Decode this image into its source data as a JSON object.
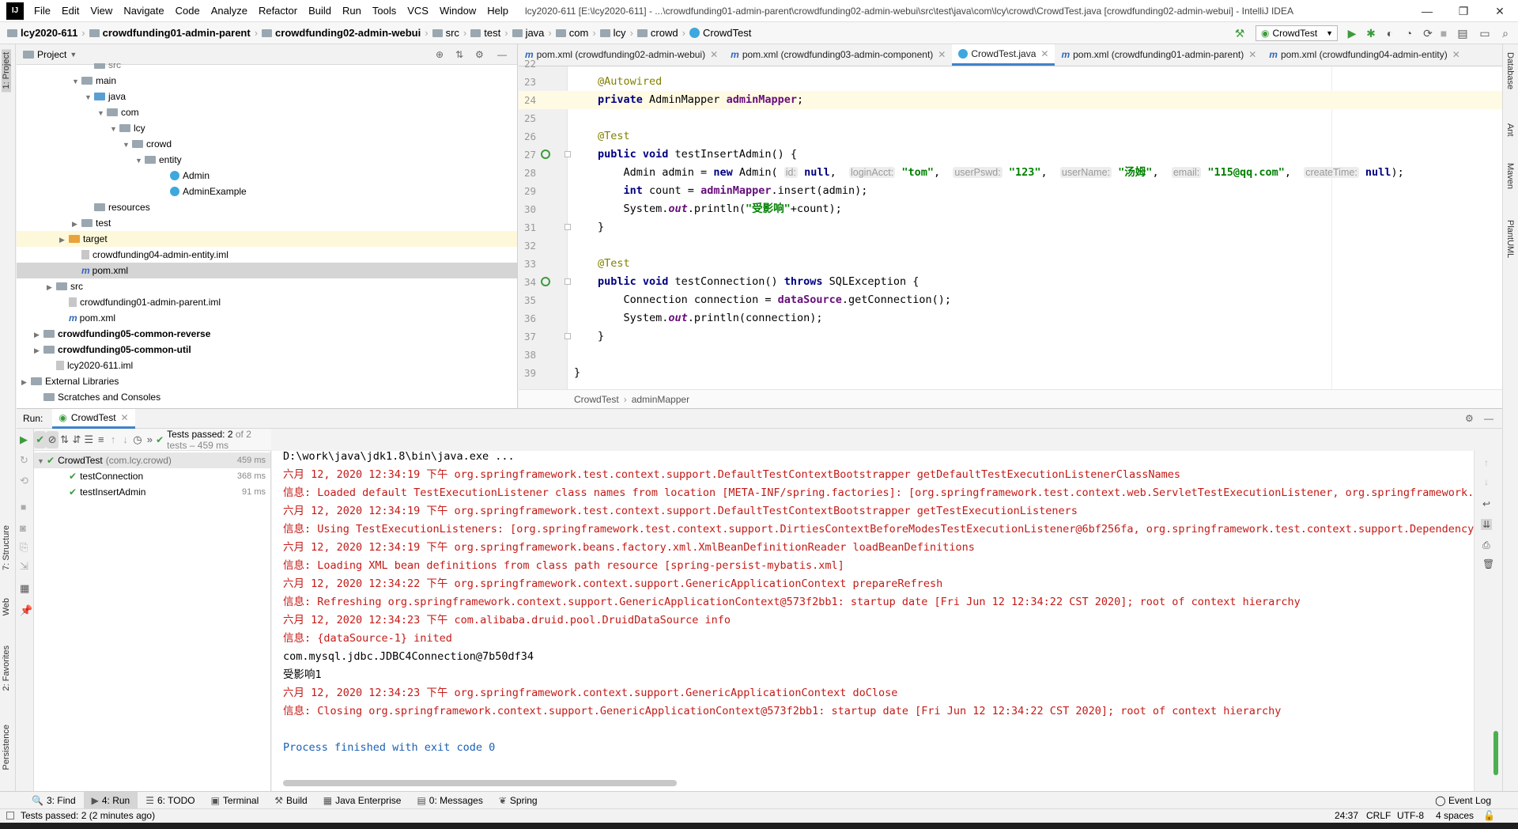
{
  "titlebar": {
    "logo": "IJ",
    "menu": [
      "File",
      "Edit",
      "View",
      "Navigate",
      "Code",
      "Analyze",
      "Refactor",
      "Build",
      "Run",
      "Tools",
      "VCS",
      "Window",
      "Help"
    ],
    "title": "lcy2020-611 [E:\\lcy2020-611] - ...\\crowdfunding01-admin-parent\\crowdfunding02-admin-webui\\src\\test\\java\\com\\lcy\\crowd\\CrowdTest.java [crowdfunding02-admin-webui] - IntelliJ IDEA",
    "minimize": "—",
    "maximize": "❐",
    "close": "✕"
  },
  "navbar": {
    "crumbs": [
      "lcy2020-611",
      "crowdfunding01-admin-parent",
      "crowdfunding02-admin-webui",
      "src",
      "test",
      "java",
      "com",
      "lcy",
      "crowd",
      "CrowdTest"
    ],
    "run_config": "CrowdTest"
  },
  "left_strip": {
    "project_tab": "1: Project",
    "structure_tab": "7: Structure",
    "web_tab": "Web",
    "favorites_tab": "2: Favorites",
    "persistence_tab": "Persistence"
  },
  "right_strip": {
    "database": "Database",
    "ant": "Ant",
    "maven": "Maven",
    "plantuml": "PlantUML"
  },
  "project": {
    "header": "Project",
    "tree": [
      {
        "label": "src",
        "indent": 5,
        "icon": "folder",
        "arrow": "",
        "cls": "grey"
      },
      {
        "label": "main",
        "indent": 4,
        "icon": "folder",
        "arrow": "▼",
        "cls": ""
      },
      {
        "label": "java",
        "indent": 5,
        "icon": "folder-blue",
        "arrow": "▼",
        "cls": ""
      },
      {
        "label": "com",
        "indent": 6,
        "icon": "folder",
        "arrow": "▼",
        "cls": ""
      },
      {
        "label": "lcy",
        "indent": 7,
        "icon": "folder",
        "arrow": "▼",
        "cls": ""
      },
      {
        "label": "crowd",
        "indent": 8,
        "icon": "folder",
        "arrow": "▼",
        "cls": ""
      },
      {
        "label": "entity",
        "indent": 9,
        "icon": "folder",
        "arrow": "▼",
        "cls": ""
      },
      {
        "label": "Admin",
        "indent": 11,
        "icon": "class",
        "arrow": "",
        "cls": ""
      },
      {
        "label": "AdminExample",
        "indent": 11,
        "icon": "class",
        "arrow": "",
        "cls": ""
      },
      {
        "label": "resources",
        "indent": 5,
        "icon": "folder",
        "arrow": "",
        "cls": ""
      },
      {
        "label": "test",
        "indent": 4,
        "icon": "folder",
        "arrow": "▶",
        "cls": ""
      },
      {
        "label": "target",
        "indent": 3,
        "icon": "folder-orange",
        "arrow": "▶",
        "cls": "hl"
      },
      {
        "label": "crowdfunding04-admin-entity.iml",
        "indent": 4,
        "icon": "file",
        "arrow": "",
        "cls": ""
      },
      {
        "label": "pom.xml",
        "indent": 4,
        "icon": "m",
        "arrow": "",
        "cls": "sel"
      },
      {
        "label": "src",
        "indent": 2,
        "icon": "folder",
        "arrow": "▶",
        "cls": ""
      },
      {
        "label": "crowdfunding01-admin-parent.iml",
        "indent": 3,
        "icon": "file",
        "arrow": "",
        "cls": ""
      },
      {
        "label": "pom.xml",
        "indent": 3,
        "icon": "m",
        "arrow": "",
        "cls": ""
      },
      {
        "label": "crowdfunding05-common-reverse",
        "indent": 1,
        "icon": "folder",
        "arrow": "▶",
        "cls": "bold"
      },
      {
        "label": "crowdfunding05-common-util",
        "indent": 1,
        "icon": "folder",
        "arrow": "▶",
        "cls": "bold"
      },
      {
        "label": "lcy2020-611.iml",
        "indent": 2,
        "icon": "file",
        "arrow": "",
        "cls": ""
      },
      {
        "label": "External Libraries",
        "indent": 0,
        "icon": "folder",
        "arrow": "▶",
        "cls": ""
      },
      {
        "label": "Scratches and Consoles",
        "indent": 1,
        "icon": "folder",
        "arrow": "",
        "cls": ""
      }
    ]
  },
  "editor": {
    "tabs": [
      {
        "label": "pom.xml (crowdfunding02-admin-webui)",
        "icon": "m",
        "active": false
      },
      {
        "label": "pom.xml (crowdfunding03-admin-component)",
        "icon": "m",
        "active": false
      },
      {
        "label": "CrowdTest.java",
        "icon": "c",
        "active": true
      },
      {
        "label": "pom.xml (crowdfunding01-admin-parent)",
        "icon": "m",
        "active": false
      },
      {
        "label": "pom.xml (crowdfunding04-admin-entity)",
        "icon": "m",
        "active": false
      }
    ],
    "line_numbers": [
      "22",
      "23",
      "24",
      "25",
      "26",
      "27",
      "28",
      "29",
      "30",
      "31",
      "32",
      "33",
      "34",
      "35",
      "36",
      "37",
      "38",
      "39"
    ],
    "breadcrumb": [
      "CrowdTest",
      "adminMapper"
    ]
  },
  "run": {
    "label": "Run:",
    "tab": "CrowdTest",
    "status": "Tests passed:",
    "status_count": "2",
    "status_detail": "of 2 tests – 459 ms",
    "tests": [
      {
        "name": "CrowdTest",
        "pkg": "(com.lcy.crowd)",
        "duration": "459 ms"
      },
      {
        "name": "testConnection",
        "pkg": "",
        "duration": "368 ms"
      },
      {
        "name": "testInsertAdmin",
        "pkg": "",
        "duration": "91 ms"
      }
    ],
    "console": [
      {
        "text": "D:\\work\\java\\jdk1.8\\bin\\java.exe ...",
        "cls": "cblack"
      },
      {
        "text": "六月 12, 2020 12:34:19 下午 org.springframework.test.context.support.DefaultTestContextBootstrapper getDefaultTestExecutionListenerClassNames",
        "cls": "cred"
      },
      {
        "text": "信息: Loaded default TestExecutionListener class names from location [META-INF/spring.factories]: [org.springframework.test.context.web.ServletTestExecutionListener, org.springframework.test",
        "cls": "cred"
      },
      {
        "text": "六月 12, 2020 12:34:19 下午 org.springframework.test.context.support.DefaultTestContextBootstrapper getTestExecutionListeners",
        "cls": "cred"
      },
      {
        "text": "信息: Using TestExecutionListeners: [org.springframework.test.context.support.DirtiesContextBeforeModesTestExecutionListener@6bf256fa, org.springframework.test.context.support.DependencyInje",
        "cls": "cred"
      },
      {
        "text": "六月 12, 2020 12:34:19 下午 org.springframework.beans.factory.xml.XmlBeanDefinitionReader loadBeanDefinitions",
        "cls": "cred"
      },
      {
        "text": "信息: Loading XML bean definitions from class path resource [spring-persist-mybatis.xml]",
        "cls": "cred"
      },
      {
        "text": "六月 12, 2020 12:34:22 下午 org.springframework.context.support.GenericApplicationContext prepareRefresh",
        "cls": "cred"
      },
      {
        "text": "信息: Refreshing org.springframework.context.support.GenericApplicationContext@573f2bb1: startup date [Fri Jun 12 12:34:22 CST 2020]; root of context hierarchy",
        "cls": "cred"
      },
      {
        "text": "六月 12, 2020 12:34:23 下午 com.alibaba.druid.pool.DruidDataSource info",
        "cls": "cred"
      },
      {
        "text": "信息: {dataSource-1} inited",
        "cls": "cred"
      },
      {
        "text": "com.mysql.jdbc.JDBC4Connection@7b50df34",
        "cls": "cblack"
      },
      {
        "text": "受影响1",
        "cls": "cblack"
      },
      {
        "text": "六月 12, 2020 12:34:23 下午 org.springframework.context.support.GenericApplicationContext doClose",
        "cls": "cred"
      },
      {
        "text": "信息: Closing org.springframework.context.support.GenericApplicationContext@573f2bb1: startup date [Fri Jun 12 12:34:22 CST 2020]; root of context hierarchy",
        "cls": "cred"
      },
      {
        "text": "",
        "cls": "cblack"
      },
      {
        "text": "Process finished with exit code 0",
        "cls": "cblue"
      }
    ]
  },
  "bottom_tools": [
    {
      "label": "3: Find",
      "icon": "🔍",
      "active": false
    },
    {
      "label": "4: Run",
      "icon": "▶",
      "active": true
    },
    {
      "label": "6: TODO",
      "icon": "☰",
      "active": false
    },
    {
      "label": "Terminal",
      "icon": "▣",
      "active": false
    },
    {
      "label": "Build",
      "icon": "⚒",
      "active": false
    },
    {
      "label": "Java Enterprise",
      "icon": "▦",
      "active": false
    },
    {
      "label": "0: Messages",
      "icon": "▤",
      "active": false
    },
    {
      "label": "Spring",
      "icon": "❦",
      "active": false
    }
  ],
  "event_log": "Event Log",
  "status": {
    "message": "Tests passed: 2 (2 minutes ago)",
    "position": "24:37",
    "line_sep": "CRLF",
    "encoding": "UTF-8",
    "indent": "4 spaces"
  }
}
